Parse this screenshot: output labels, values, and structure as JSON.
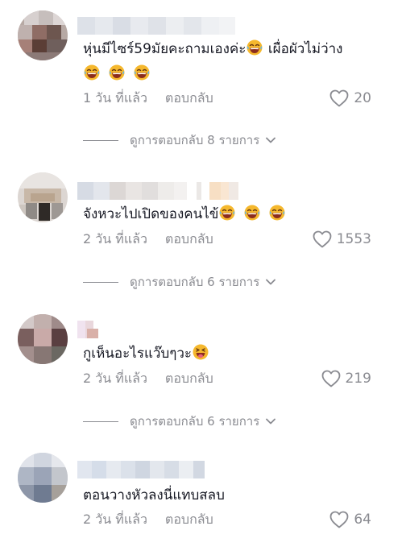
{
  "comments": [
    {
      "text": "หุ่นมีไซร์59มัยคะถามเองค่ะ",
      "text_after": " เผื่อผัวไม่ว่าง",
      "emoji_inline": "laughing-emoji",
      "emoji_line2_count": 3,
      "time": "1 วัน ที่แล้ว",
      "reply_label": "ตอบกลับ",
      "likes": "20",
      "view_replies": "ดูการตอบกลับ 8 รายการ"
    },
    {
      "text": "จังหวะไปเปิดของคนไข้",
      "emoji_inline_count": 3,
      "time": "2 วัน ที่แล้ว",
      "reply_label": "ตอบกลับ",
      "likes": "1553",
      "view_replies": "ดูการตอบกลับ 6 รายการ"
    },
    {
      "text": "กูเห็นอะไรแว๊บๆวะ",
      "emoji_inline": "tongue-emoji",
      "time": "2 วัน ที่แล้ว",
      "reply_label": "ตอบกลับ",
      "likes": "219",
      "view_replies": "ดูการตอบกลับ 6 รายการ"
    },
    {
      "text": "ตอนวางหัวลงนี่แทบสลบ",
      "time": "2 วัน ที่แล้ว",
      "reply_label": "ตอบกลับ",
      "likes": "64"
    }
  ],
  "colors": {
    "text": "#161823",
    "muted": "#8a8b91",
    "emoji_face": "#f5b82e",
    "emoji_mouth": "#8b2d1e"
  },
  "icons": [
    "heart-outline-icon",
    "chevron-down-icon",
    "laughing-emoji",
    "tongue-emoji"
  ]
}
